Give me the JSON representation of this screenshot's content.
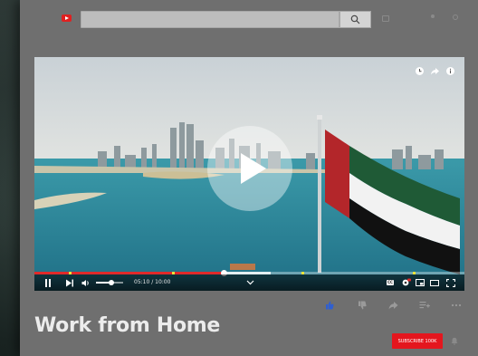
{
  "search": {
    "placeholder": "",
    "value": ""
  },
  "icons": {
    "logo": "youtube-logo-icon",
    "search": "search-icon",
    "camera": "create-video-icon",
    "apps": "apps-dot-icon",
    "notifications": "notification-bell-icon"
  },
  "player": {
    "time_display": "05:10 / 10:00",
    "progress_fraction": 0.44,
    "buffer_fraction": 0.55,
    "volume_fraction": 0.55,
    "chapter_markers": [
      0.08,
      0.32,
      0.62,
      0.88
    ],
    "cc_label": "CC"
  },
  "video": {
    "title": "Work from Home"
  },
  "channel": {
    "subscribe_label": "SUBSCRIBE 100K"
  },
  "colors": {
    "accent_red": "#e02a2a",
    "subscribe_red": "#e4161e",
    "panel_grey": "#6f6f6f",
    "like_blue": "#2f5fd0",
    "chapter_yellow": "#e9e33a"
  }
}
